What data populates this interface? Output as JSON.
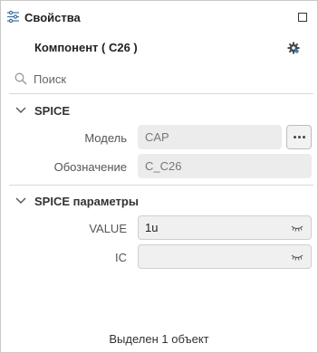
{
  "panel": {
    "title": "Свойства",
    "title_icon": "sliders-icon",
    "maximize_icon": "maximize-icon"
  },
  "component": {
    "name": "Компонент ( C26 )",
    "settings_icon": "gear-icon"
  },
  "search": {
    "placeholder": "Поиск",
    "value": ""
  },
  "sections": [
    {
      "title": "SPICE",
      "expanded": true,
      "properties": [
        {
          "label": "Модель",
          "value": "CAP",
          "has_more_button": true
        },
        {
          "label": "Обозначение",
          "value": "C_C26"
        }
      ]
    },
    {
      "title": "SPICE параметры",
      "expanded": true,
      "properties": [
        {
          "label": "VALUE",
          "value": "1u",
          "visibility_icon": "eye-closed-icon"
        },
        {
          "label": "IC",
          "value": "",
          "visibility_icon": "eye-closed-icon"
        }
      ]
    }
  ],
  "status": "Выделен 1 объект"
}
